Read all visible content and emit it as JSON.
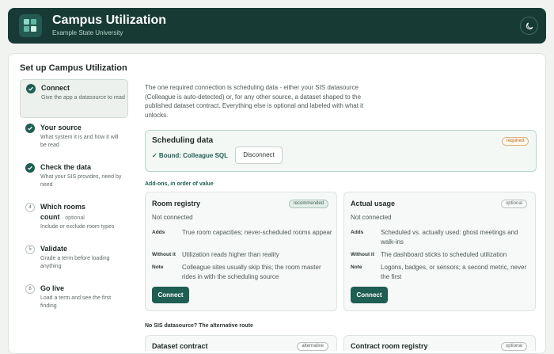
{
  "header": {
    "title": "Campus Utilization",
    "subtitle": "Example State University",
    "theme_toggle": "moon-icon"
  },
  "setup": {
    "title": "Set up Campus Utilization",
    "steps": [
      {
        "name": "Connect",
        "desc": "Give the app a datasource to read",
        "state": "done"
      },
      {
        "name": "Your source",
        "desc": "What system it is and how it will be read",
        "state": "done"
      },
      {
        "name": "Check the data",
        "desc": "What your SIS provides, need by need",
        "state": "done"
      },
      {
        "number": "4",
        "name_a": "Which rooms",
        "name_b": "count",
        "optional": "· optional",
        "desc": "Include or exclude room types",
        "state": "todo"
      },
      {
        "number": "5",
        "name": "Validate",
        "desc": "Grade a term before loading anything",
        "state": "todo"
      },
      {
        "number": "6",
        "name": "Go live",
        "desc": "Load a term and see the first finding",
        "state": "todo"
      }
    ]
  },
  "main": {
    "intro": "The one required connection is scheduling data - either your SIS datasource (Colleague is auto-detected) or, for any other source, a dataset shaped to the published dataset contract. Everything else is optional and labeled with what it unlocks.",
    "scheduling": {
      "title": "Scheduling data",
      "badge": "required",
      "bound": "✓ Bound: Colleague SQL",
      "disconnect": "Disconnect"
    },
    "addons_label": "Add-ons, in order of value",
    "addons": [
      {
        "title": "Room registry",
        "badge": "recommended",
        "status": "Not connected",
        "rows": [
          {
            "k": "Adds",
            "v": "True room capacities; never-scheduled rooms appear"
          },
          {
            "k": "Without it",
            "v": "Utilization reads higher than reality"
          },
          {
            "k": "Note",
            "v": "Colleague sites usually skip this; the room master rides in with the scheduling source"
          }
        ],
        "button": "Connect"
      },
      {
        "title": "Actual usage",
        "badge": "optional",
        "status": "Not connected",
        "rows": [
          {
            "k": "Adds",
            "v": "Scheduled vs. actually used: ghost meetings and walk-ins"
          },
          {
            "k": "Without it",
            "v": "The dashboard sticks to scheduled utilization"
          },
          {
            "k": "Note",
            "v": "Logons, badges, or sensors; a second metric, never the first"
          }
        ],
        "button": "Connect"
      }
    ],
    "alt_label": "No SIS datasource? The alternative route",
    "alt_cards": [
      {
        "title": "Dataset contract",
        "badge": "alternative"
      },
      {
        "title": "Contract room registry",
        "badge": "optional"
      }
    ]
  }
}
